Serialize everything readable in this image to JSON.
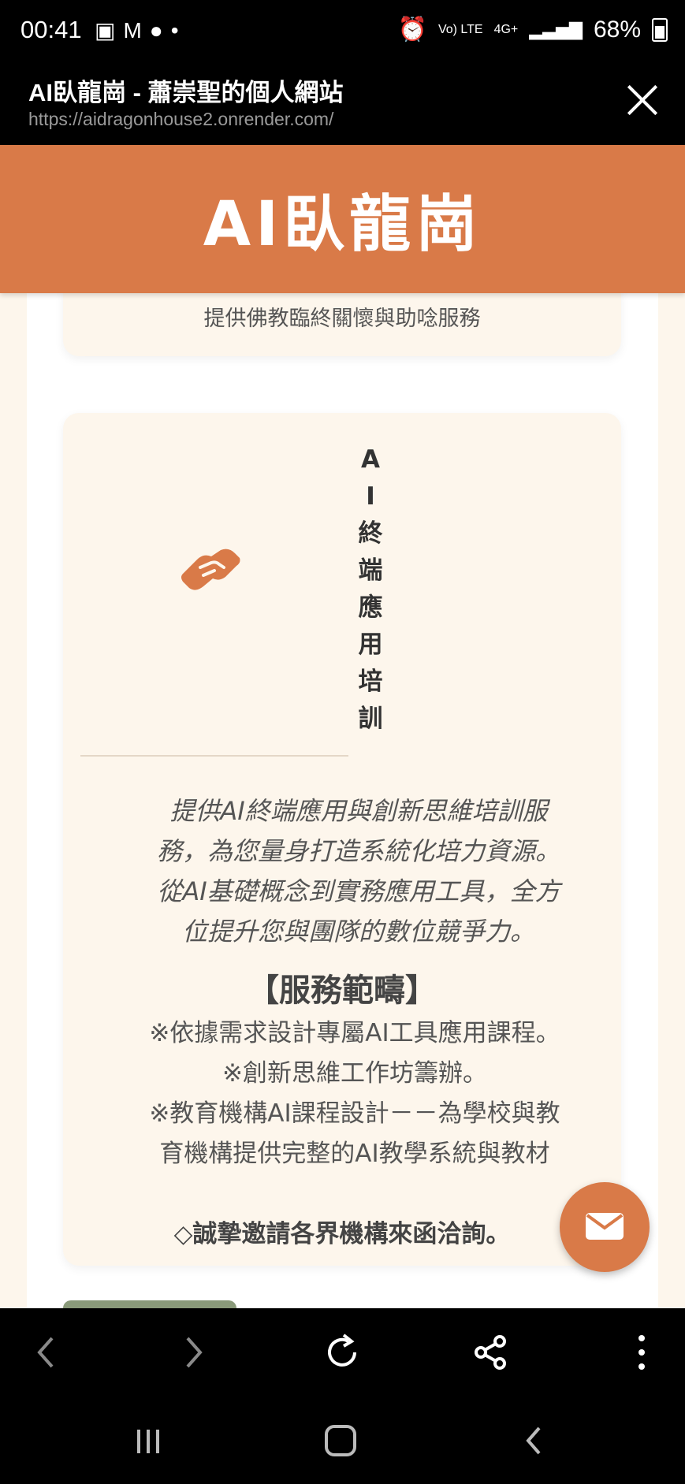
{
  "status_bar": {
    "time": "00:41",
    "battery": "68%",
    "network_volte": "Vo) LTE",
    "network_4g": "4G+"
  },
  "tab": {
    "title": "AI臥龍崗 - 蕭崇聖的個人網站",
    "url": "https://aidragonhouse2.onrender.com/"
  },
  "header": {
    "brand": "AI臥龍崗"
  },
  "cards": {
    "prev_desc": "提供佛教臨終關懷與助唸服務",
    "ai_title_chars": [
      "A",
      "I",
      "終",
      "端",
      "應",
      "用",
      "培",
      "訓"
    ],
    "ai_desc": "提供AI終端應用與創新思維培訓服務，為您量身打造系統化培力資源。從AI基礎概念到實務應用工具，全方位提升您與團隊的數位競爭力。",
    "scope_heading": "【服務範疇】",
    "scope_items": [
      "※依據需求設計專屬AI工具應用課程。",
      "※創新思維工作坊籌辦。",
      "※教育機構AI課程設計－－為學校與教育機構提供完整的AI教學系統與教材"
    ],
    "invite": "◇誠摯邀請各界機構來函洽詢。"
  },
  "colors": {
    "accent": "#d97a48",
    "card_bg": "#fdf6ec"
  },
  "icons": [
    "image-icon",
    "gmail-icon",
    "piggy-bank-icon",
    "alarm-icon",
    "signal-icon",
    "battery-icon",
    "close-icon",
    "handshake-icon",
    "envelope-icon",
    "back-icon",
    "forward-icon",
    "reload-icon",
    "share-icon",
    "more-icon",
    "recents-icon",
    "home-icon",
    "nav-back-icon"
  ]
}
